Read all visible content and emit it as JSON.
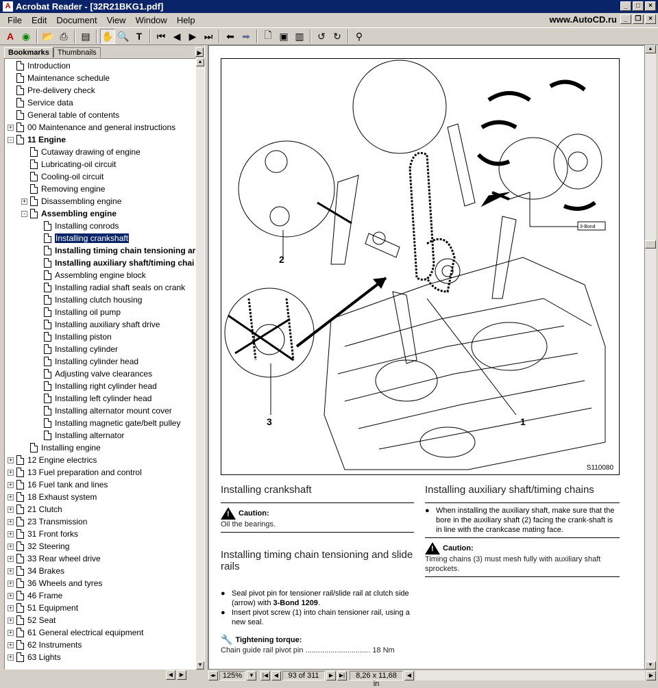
{
  "window": {
    "title": "Acrobat Reader - [32R21BKG1.pdf]",
    "app_icon": "acrobat-icon",
    "site": "www.AutoCD.ru"
  },
  "menu": [
    "File",
    "Edit",
    "Document",
    "View",
    "Window",
    "Help"
  ],
  "tabs": {
    "bookmarks": "Bookmarks",
    "thumbnails": "Thumbnails"
  },
  "bookmarks": [
    {
      "label": "Introduction",
      "level": 0,
      "expander": ""
    },
    {
      "label": "Maintenance schedule",
      "level": 0,
      "expander": ""
    },
    {
      "label": "Pre-delivery check",
      "level": 0,
      "expander": ""
    },
    {
      "label": "Service data",
      "level": 0,
      "expander": ""
    },
    {
      "label": "General table of contents",
      "level": 0,
      "expander": ""
    },
    {
      "label": "00 Maintenance and general instructions",
      "level": 0,
      "expander": "+"
    },
    {
      "label": "11 Engine",
      "level": 0,
      "expander": "-",
      "bold": true
    },
    {
      "label": "Cutaway drawing of engine",
      "level": 1,
      "expander": ""
    },
    {
      "label": "Lubricating-oil circuit",
      "level": 1,
      "expander": ""
    },
    {
      "label": "Cooling-oil circuit",
      "level": 1,
      "expander": ""
    },
    {
      "label": "Removing engine",
      "level": 1,
      "expander": ""
    },
    {
      "label": "Disassembling engine",
      "level": 1,
      "expander": "+"
    },
    {
      "label": "Assembling engine",
      "level": 1,
      "expander": "-",
      "bold": true
    },
    {
      "label": "Installing conrods",
      "level": 2,
      "expander": ""
    },
    {
      "label": "Installing crankshaft",
      "level": 2,
      "expander": "",
      "selected": true
    },
    {
      "label": "Installing timing chain tensioning ar",
      "level": 2,
      "expander": "",
      "bold": true
    },
    {
      "label": "Installing auxiliary shaft/timing chai",
      "level": 2,
      "expander": "",
      "bold": true
    },
    {
      "label": "Assembling engine block",
      "level": 2,
      "expander": ""
    },
    {
      "label": "Installing radial shaft seals on  crank",
      "level": 2,
      "expander": ""
    },
    {
      "label": "Installing clutch housing",
      "level": 2,
      "expander": ""
    },
    {
      "label": "Installing oil pump",
      "level": 2,
      "expander": ""
    },
    {
      "label": "Installing auxiliary shaft drive",
      "level": 2,
      "expander": ""
    },
    {
      "label": "Installing piston",
      "level": 2,
      "expander": ""
    },
    {
      "label": "Installing cylinder",
      "level": 2,
      "expander": ""
    },
    {
      "label": "Installing cylinder head",
      "level": 2,
      "expander": ""
    },
    {
      "label": "Adjusting valve clearances",
      "level": 2,
      "expander": ""
    },
    {
      "label": "Installing right cylinder head",
      "level": 2,
      "expander": ""
    },
    {
      "label": "Installing left cylinder head",
      "level": 2,
      "expander": ""
    },
    {
      "label": "Installing alternator mount cover",
      "level": 2,
      "expander": ""
    },
    {
      "label": "Installing magnetic gate/belt pulley",
      "level": 2,
      "expander": ""
    },
    {
      "label": "Installing alternator",
      "level": 2,
      "expander": ""
    },
    {
      "label": "Installing engine",
      "level": 1,
      "expander": ""
    },
    {
      "label": "12 Engine electrics",
      "level": 0,
      "expander": "+"
    },
    {
      "label": "13 Fuel preparation and control",
      "level": 0,
      "expander": "+"
    },
    {
      "label": "16 Fuel tank and lines",
      "level": 0,
      "expander": "+"
    },
    {
      "label": "18 Exhaust system",
      "level": 0,
      "expander": "+"
    },
    {
      "label": "21 Clutch",
      "level": 0,
      "expander": "+"
    },
    {
      "label": "23 Transmission",
      "level": 0,
      "expander": "+"
    },
    {
      "label": "31 Front forks",
      "level": 0,
      "expander": "+"
    },
    {
      "label": "32 Steering",
      "level": 0,
      "expander": "+"
    },
    {
      "label": "33 Rear wheel drive",
      "level": 0,
      "expander": "+"
    },
    {
      "label": "34 Brakes",
      "level": 0,
      "expander": "+"
    },
    {
      "label": "36 Wheels and tyres",
      "level": 0,
      "expander": "+"
    },
    {
      "label": "46 Frame",
      "level": 0,
      "expander": "+"
    },
    {
      "label": "51 Equipment",
      "level": 0,
      "expander": "+"
    },
    {
      "label": "52 Seat",
      "level": 0,
      "expander": "+"
    },
    {
      "label": "61 General electrical equipment",
      "level": 0,
      "expander": "+"
    },
    {
      "label": "62 Instruments",
      "level": 0,
      "expander": "+"
    },
    {
      "label": "63 Lights",
      "level": 0,
      "expander": "+"
    }
  ],
  "figure": {
    "id": "S110080",
    "callouts": [
      "1",
      "2",
      "3"
    ],
    "bond_label": "3-Bond"
  },
  "doc": {
    "left": {
      "h1": "Installing crankshaft",
      "caution1_title": "Caution:",
      "caution1_text": "Oil the bearings.",
      "h2": "Installing timing chain tensioning and slide rails",
      "bullet1_pre": "Seal pivot pin for tensioner rail/slide rail at clutch side (arrow) with ",
      "bullet1_bold": "3-Bond 1209",
      "bullet1_post": ".",
      "bullet2": "Insert pivot screw (1) into chain tensioner rail, using a new seal.",
      "torque_title": "Tightening torque:",
      "torque_text": "Chain guide rail pivot pin ............................... 18 Nm"
    },
    "right": {
      "h1": "Installing auxiliary shaft/timing chains",
      "bullet1": "When installing the auxiliary shaft, make sure that the bore in the auxiliary shaft (2) facing the crank-shaft is in line with the crankcase mating face.",
      "caution_title": "Caution:",
      "caution_text": "Timing chains (3) must mesh fully with auxiliary shaft sprockets."
    }
  },
  "status": {
    "zoom": "125%",
    "page": "93 of 311",
    "size": "8,26 x 11,68 in"
  }
}
